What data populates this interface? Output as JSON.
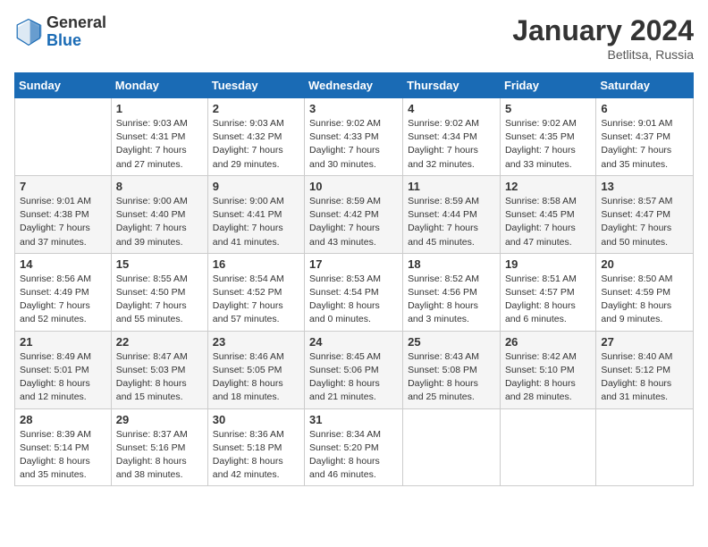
{
  "logo": {
    "general": "General",
    "blue": "Blue"
  },
  "title": "January 2024",
  "location": "Betlitsa, Russia",
  "days_of_week": [
    "Sunday",
    "Monday",
    "Tuesday",
    "Wednesday",
    "Thursday",
    "Friday",
    "Saturday"
  ],
  "weeks": [
    [
      {
        "day": "",
        "info": ""
      },
      {
        "day": "1",
        "info": "Sunrise: 9:03 AM\nSunset: 4:31 PM\nDaylight: 7 hours\nand 27 minutes."
      },
      {
        "day": "2",
        "info": "Sunrise: 9:03 AM\nSunset: 4:32 PM\nDaylight: 7 hours\nand 29 minutes."
      },
      {
        "day": "3",
        "info": "Sunrise: 9:02 AM\nSunset: 4:33 PM\nDaylight: 7 hours\nand 30 minutes."
      },
      {
        "day": "4",
        "info": "Sunrise: 9:02 AM\nSunset: 4:34 PM\nDaylight: 7 hours\nand 32 minutes."
      },
      {
        "day": "5",
        "info": "Sunrise: 9:02 AM\nSunset: 4:35 PM\nDaylight: 7 hours\nand 33 minutes."
      },
      {
        "day": "6",
        "info": "Sunrise: 9:01 AM\nSunset: 4:37 PM\nDaylight: 7 hours\nand 35 minutes."
      }
    ],
    [
      {
        "day": "7",
        "info": "Sunrise: 9:01 AM\nSunset: 4:38 PM\nDaylight: 7 hours\nand 37 minutes."
      },
      {
        "day": "8",
        "info": "Sunrise: 9:00 AM\nSunset: 4:40 PM\nDaylight: 7 hours\nand 39 minutes."
      },
      {
        "day": "9",
        "info": "Sunrise: 9:00 AM\nSunset: 4:41 PM\nDaylight: 7 hours\nand 41 minutes."
      },
      {
        "day": "10",
        "info": "Sunrise: 8:59 AM\nSunset: 4:42 PM\nDaylight: 7 hours\nand 43 minutes."
      },
      {
        "day": "11",
        "info": "Sunrise: 8:59 AM\nSunset: 4:44 PM\nDaylight: 7 hours\nand 45 minutes."
      },
      {
        "day": "12",
        "info": "Sunrise: 8:58 AM\nSunset: 4:45 PM\nDaylight: 7 hours\nand 47 minutes."
      },
      {
        "day": "13",
        "info": "Sunrise: 8:57 AM\nSunset: 4:47 PM\nDaylight: 7 hours\nand 50 minutes."
      }
    ],
    [
      {
        "day": "14",
        "info": "Sunrise: 8:56 AM\nSunset: 4:49 PM\nDaylight: 7 hours\nand 52 minutes."
      },
      {
        "day": "15",
        "info": "Sunrise: 8:55 AM\nSunset: 4:50 PM\nDaylight: 7 hours\nand 55 minutes."
      },
      {
        "day": "16",
        "info": "Sunrise: 8:54 AM\nSunset: 4:52 PM\nDaylight: 7 hours\nand 57 minutes."
      },
      {
        "day": "17",
        "info": "Sunrise: 8:53 AM\nSunset: 4:54 PM\nDaylight: 8 hours\nand 0 minutes."
      },
      {
        "day": "18",
        "info": "Sunrise: 8:52 AM\nSunset: 4:56 PM\nDaylight: 8 hours\nand 3 minutes."
      },
      {
        "day": "19",
        "info": "Sunrise: 8:51 AM\nSunset: 4:57 PM\nDaylight: 8 hours\nand 6 minutes."
      },
      {
        "day": "20",
        "info": "Sunrise: 8:50 AM\nSunset: 4:59 PM\nDaylight: 8 hours\nand 9 minutes."
      }
    ],
    [
      {
        "day": "21",
        "info": "Sunrise: 8:49 AM\nSunset: 5:01 PM\nDaylight: 8 hours\nand 12 minutes."
      },
      {
        "day": "22",
        "info": "Sunrise: 8:47 AM\nSunset: 5:03 PM\nDaylight: 8 hours\nand 15 minutes."
      },
      {
        "day": "23",
        "info": "Sunrise: 8:46 AM\nSunset: 5:05 PM\nDaylight: 8 hours\nand 18 minutes."
      },
      {
        "day": "24",
        "info": "Sunrise: 8:45 AM\nSunset: 5:06 PM\nDaylight: 8 hours\nand 21 minutes."
      },
      {
        "day": "25",
        "info": "Sunrise: 8:43 AM\nSunset: 5:08 PM\nDaylight: 8 hours\nand 25 minutes."
      },
      {
        "day": "26",
        "info": "Sunrise: 8:42 AM\nSunset: 5:10 PM\nDaylight: 8 hours\nand 28 minutes."
      },
      {
        "day": "27",
        "info": "Sunrise: 8:40 AM\nSunset: 5:12 PM\nDaylight: 8 hours\nand 31 minutes."
      }
    ],
    [
      {
        "day": "28",
        "info": "Sunrise: 8:39 AM\nSunset: 5:14 PM\nDaylight: 8 hours\nand 35 minutes."
      },
      {
        "day": "29",
        "info": "Sunrise: 8:37 AM\nSunset: 5:16 PM\nDaylight: 8 hours\nand 38 minutes."
      },
      {
        "day": "30",
        "info": "Sunrise: 8:36 AM\nSunset: 5:18 PM\nDaylight: 8 hours\nand 42 minutes."
      },
      {
        "day": "31",
        "info": "Sunrise: 8:34 AM\nSunset: 5:20 PM\nDaylight: 8 hours\nand 46 minutes."
      },
      {
        "day": "",
        "info": ""
      },
      {
        "day": "",
        "info": ""
      },
      {
        "day": "",
        "info": ""
      }
    ]
  ],
  "colors": {
    "header_bg": "#1a6bb5",
    "header_text": "#ffffff",
    "accent_blue": "#1a6bb5"
  }
}
